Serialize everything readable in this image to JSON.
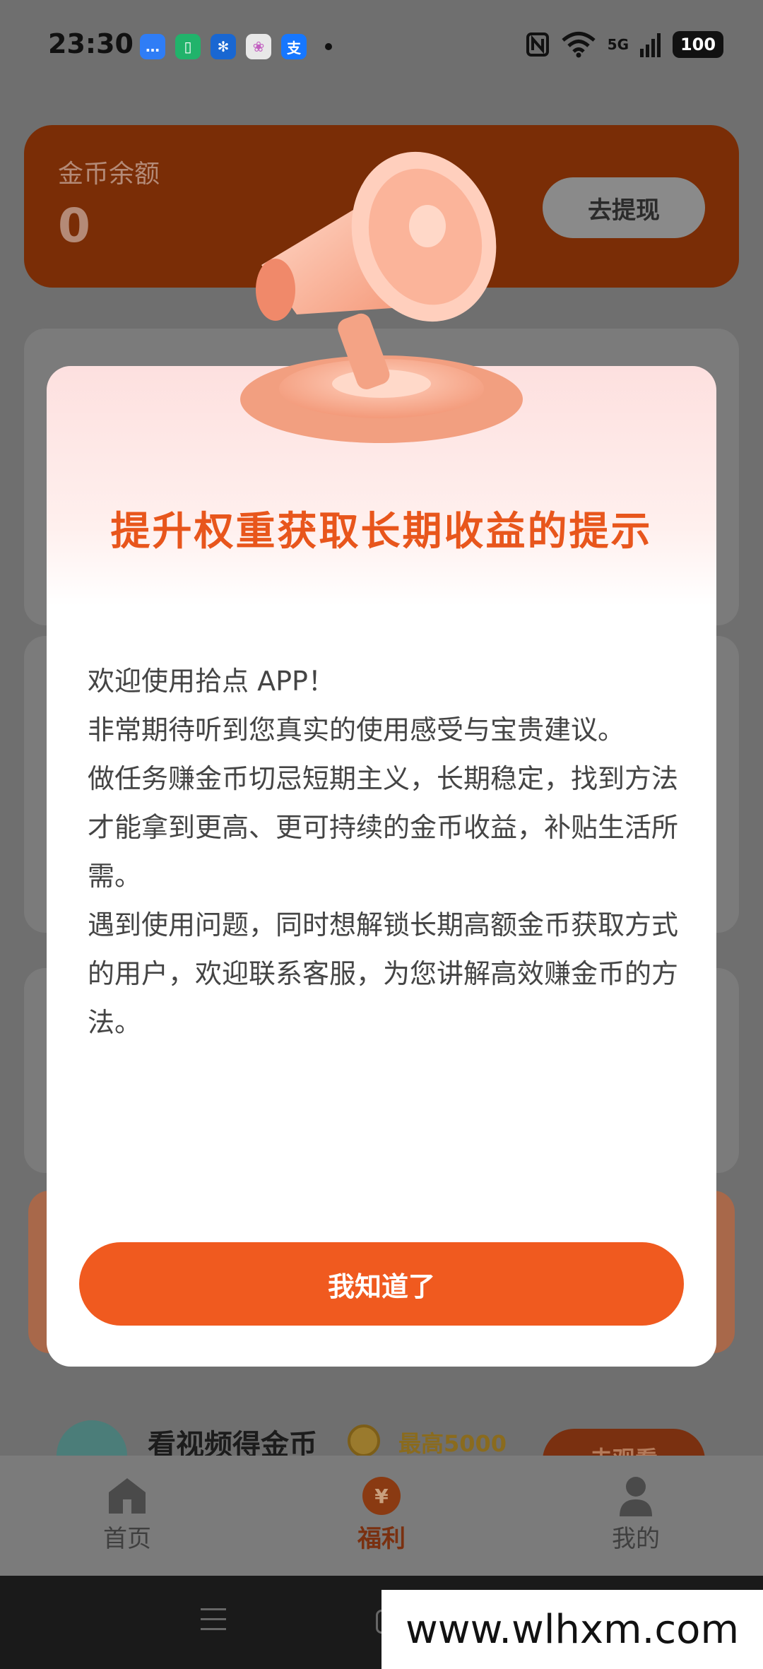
{
  "status": {
    "time": "23:30",
    "apps": [
      {
        "name": "messages-icon",
        "color": "#2f7df6",
        "glyph": "…"
      },
      {
        "name": "phone-manager-icon",
        "color": "#21b36b",
        "glyph": "▯"
      },
      {
        "name": "pinwheel-icon",
        "color": "#1967d2",
        "glyph": "✻"
      },
      {
        "name": "photos-icon",
        "color": "#e8e8e8",
        "glyph": "❀"
      },
      {
        "name": "alipay-icon",
        "color": "#1677ff",
        "glyph": "支"
      }
    ],
    "network": "5G",
    "battery": "100"
  },
  "balance": {
    "label": "金币余额",
    "value": "0",
    "withdraw_label": "去提现"
  },
  "task": {
    "title": "看视频得金币",
    "max": "最高5000",
    "button": "去观看"
  },
  "tabs": [
    {
      "label": "首页",
      "active": false
    },
    {
      "label": "福利",
      "active": true
    },
    {
      "label": "我的",
      "active": false
    }
  ],
  "modal": {
    "title": "提升权重获取长期收益的提示",
    "paragraphs": [
      "欢迎使用拾点 APP！",
      "非常期待听到您真实的使用感受与宝贵建议。",
      "做任务赚金币切忌短期主义，长期稳定，找到方法才能拿到更高、更可持续的金币收益，补贴生活所需。",
      "遇到使用问题，同时想解锁长期高额金币获取方式的用户，欢迎联系客服，为您讲解高效赚金币的方法。"
    ],
    "confirm": "我知道了"
  },
  "watermark": "www.wlhxm.com"
}
